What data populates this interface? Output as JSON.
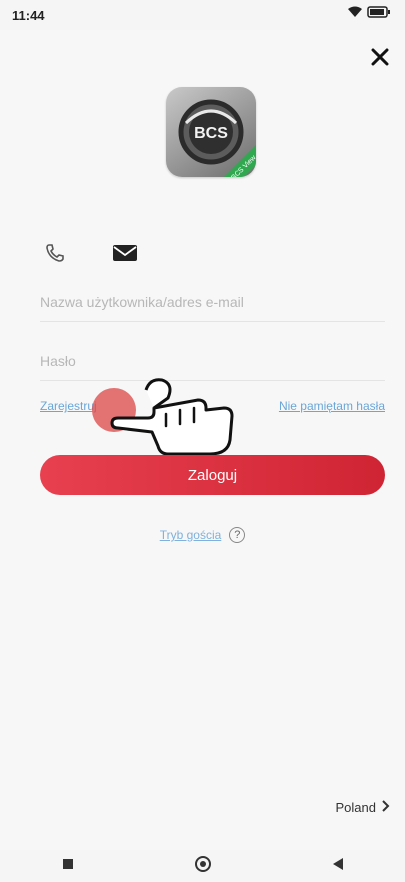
{
  "status_bar": {
    "time": "11:44",
    "icons": [
      "wifi-icon",
      "battery-icon"
    ]
  },
  "header": {
    "close_icon": "close-icon"
  },
  "logo": {
    "text": "BCS",
    "ribbon_text": "BCS View"
  },
  "tabs": [
    {
      "icon": "phone-icon"
    },
    {
      "icon": "mail-icon"
    }
  ],
  "form": {
    "username_placeholder": "Nazwa użytkownika/adres e-mail",
    "password_placeholder": "Hasło"
  },
  "links": {
    "register": "Zarejestruj",
    "forgot_password": "Nie pamiętam hasła",
    "guest_mode": "Tryb gościa"
  },
  "buttons": {
    "login": "Zaloguj"
  },
  "footer": {
    "region": "Poland"
  },
  "colors": {
    "accent": "#d9303f",
    "link": "#6aa6d8"
  }
}
